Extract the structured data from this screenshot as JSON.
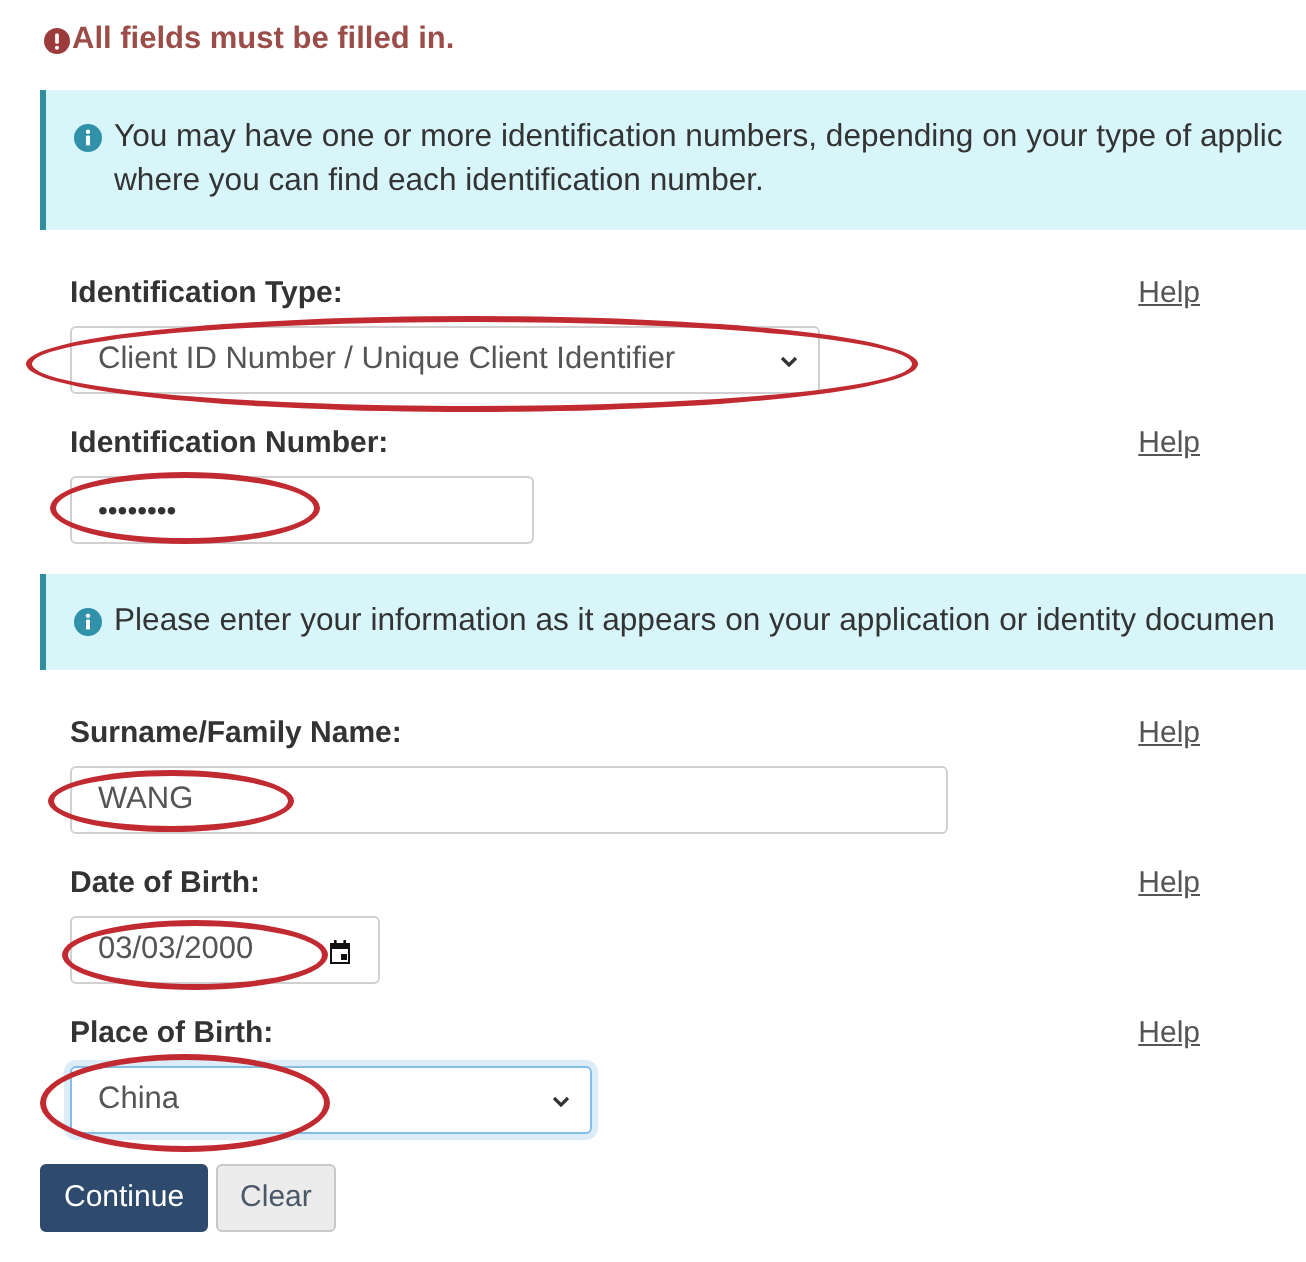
{
  "alert": {
    "text": "All fields must be filled in."
  },
  "sections": [
    {
      "notice": {
        "lines": [
          "You may have one or more identification numbers, depending on your type of applic",
          "where you can find each identification number."
        ]
      },
      "fields": [
        {
          "label": "Identification Type:",
          "help": "Help",
          "kind": "select",
          "value": "Client ID Number / Unique Client Identifier",
          "circled": true,
          "focused": false
        },
        {
          "label": "Identification Number:",
          "help": "Help",
          "kind": "password",
          "value": "••••••••",
          "circled": true,
          "focused": false
        }
      ]
    },
    {
      "notice": {
        "lines": [
          "Please enter your information as it appears on your application or identity documen"
        ]
      },
      "fields": [
        {
          "label": "Surname/Family Name:",
          "help": "Help",
          "kind": "text",
          "value": "WANG",
          "circled": true,
          "focused": false
        },
        {
          "label": "Date of Birth:",
          "help": "Help",
          "kind": "date",
          "value": "03/03/2000",
          "circled": true,
          "focused": false
        },
        {
          "label": "Place of Birth:",
          "help": "Help",
          "kind": "select",
          "value": "China",
          "circled": true,
          "focused": true
        }
      ]
    }
  ],
  "buttons": [
    {
      "label": "Continue",
      "kind": "primary"
    },
    {
      "label": "Clear",
      "kind": "secondary"
    }
  ]
}
